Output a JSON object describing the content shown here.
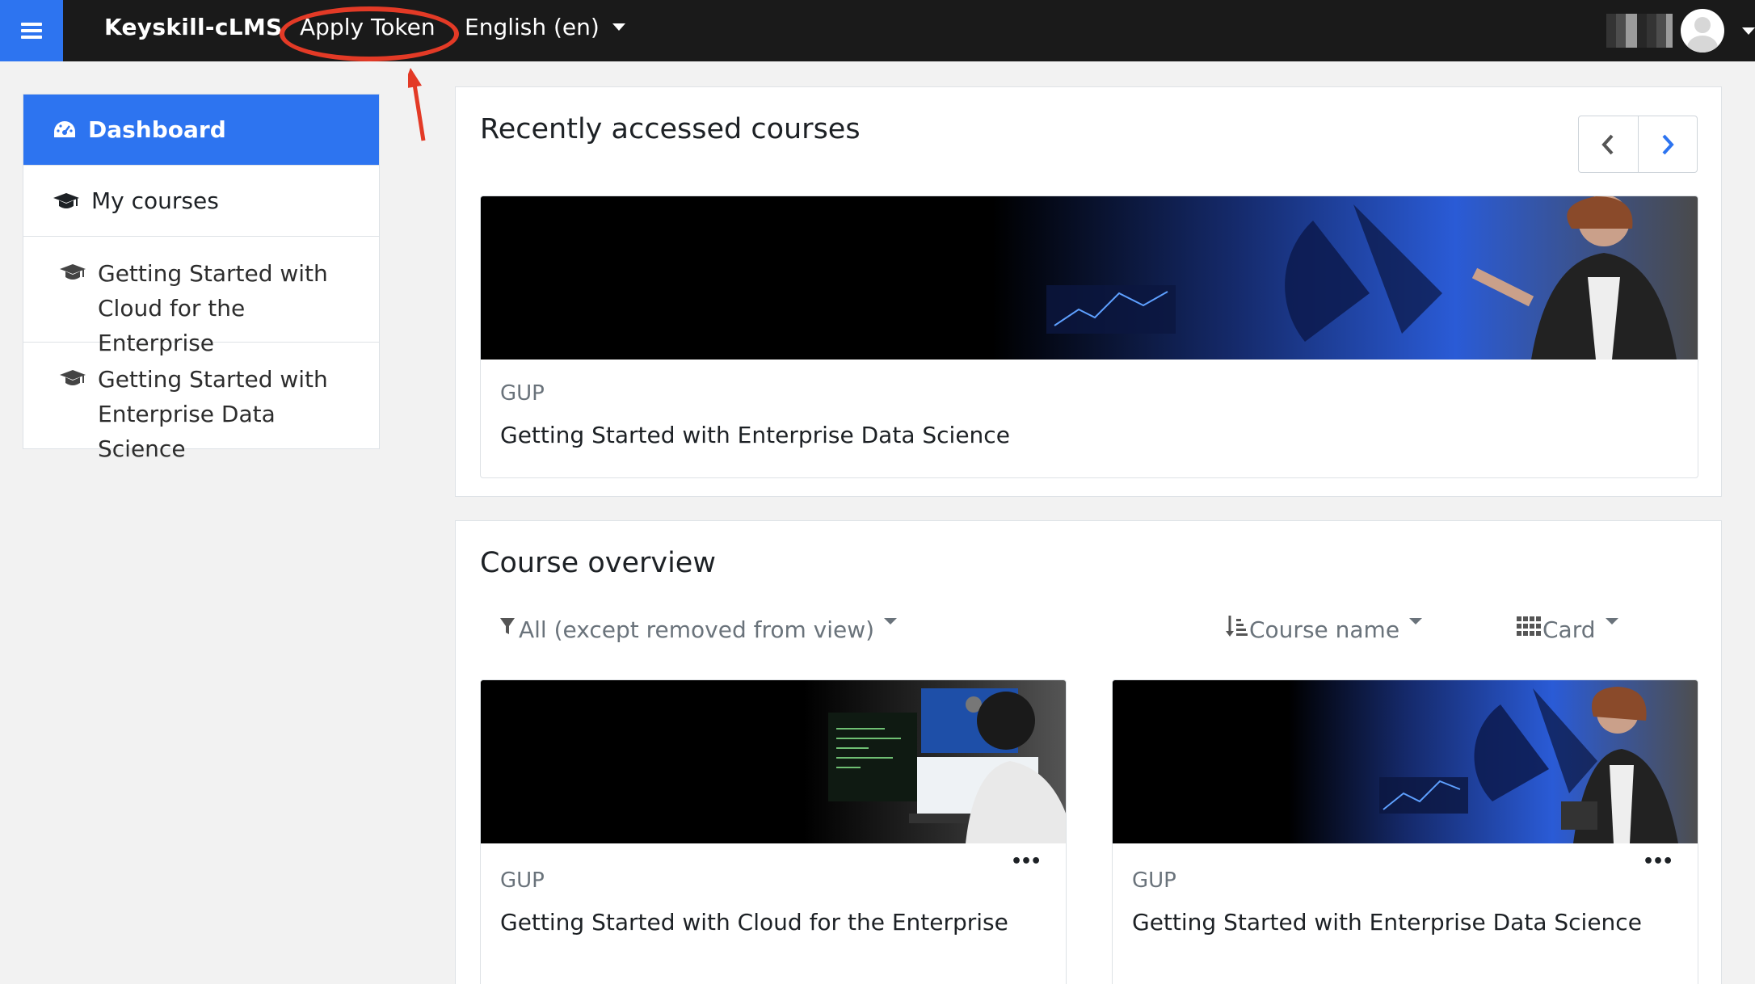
{
  "navbar": {
    "brand": "Keyskill-cLMS",
    "apply_token": "Apply Token",
    "language": "English (en)"
  },
  "sidebar": {
    "items": [
      {
        "label": "Dashboard",
        "icon": "dashboard-icon",
        "active": true
      },
      {
        "label": "My courses",
        "icon": "graduation-cap-icon"
      },
      {
        "label": "Getting Started with Cloud for the Enterprise",
        "icon": "graduation-cap-icon"
      },
      {
        "label": "Getting Started with Enterprise Data Science",
        "icon": "graduation-cap-icon"
      }
    ]
  },
  "recent": {
    "title": "Recently accessed courses",
    "course": {
      "category": "GUP",
      "name": "Getting Started with Enterprise Data Science"
    }
  },
  "overview": {
    "title": "Course overview",
    "filter_label": "All (except removed from view)",
    "sort_label": "Course name",
    "view_label": "Card",
    "courses": [
      {
        "category": "GUP",
        "name": "Getting Started with Cloud for the Enterprise"
      },
      {
        "category": "GUP",
        "name": "Getting Started with Enterprise Data Science"
      }
    ]
  },
  "colors": {
    "brand_blue": "#2d74f0",
    "navbar": "#1a1a1a",
    "annotation": "#e33a26"
  }
}
